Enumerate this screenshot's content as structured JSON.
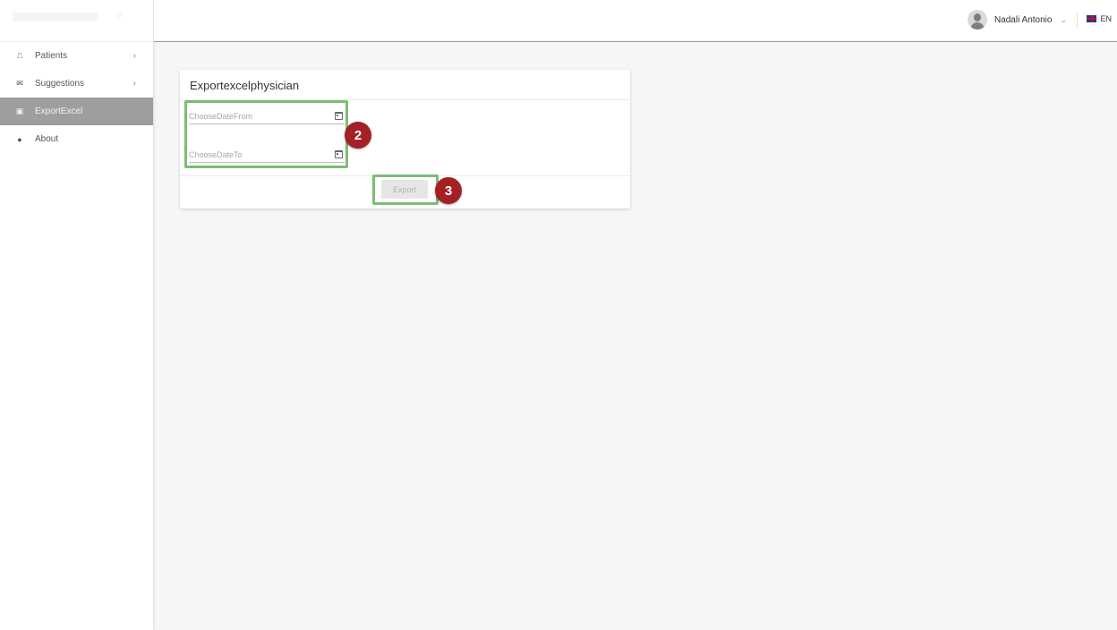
{
  "sidebar": {
    "items": [
      {
        "label": "Patients",
        "icon": "bed-icon",
        "glyph": "⎍",
        "has_chevron": true,
        "chevron": "›"
      },
      {
        "label": "Suggestions",
        "icon": "envelope-icon",
        "glyph": "✉",
        "has_chevron": true,
        "chevron": "›"
      },
      {
        "label": "ExportExcel",
        "icon": "save-icon",
        "glyph": "▣",
        "active": true
      },
      {
        "label": "About",
        "icon": "info-icon",
        "glyph": "●"
      }
    ]
  },
  "header": {
    "user_name": "Nadali Antonio",
    "user_chevron": "⌄",
    "language": "EN"
  },
  "card": {
    "title": "Exportexcelphysician",
    "date_from_placeholder": "ChooseDateFrom",
    "date_to_placeholder": "ChooseDateTo",
    "export_label": "Export"
  },
  "annotations": {
    "badge_fields": "2",
    "badge_export": "3",
    "highlight_color": "#7cbd76",
    "badge_color": "#a32024"
  },
  "colors": {
    "active_menu_bg": "#9e9e9e",
    "page_bg": "#f5f6f8"
  }
}
